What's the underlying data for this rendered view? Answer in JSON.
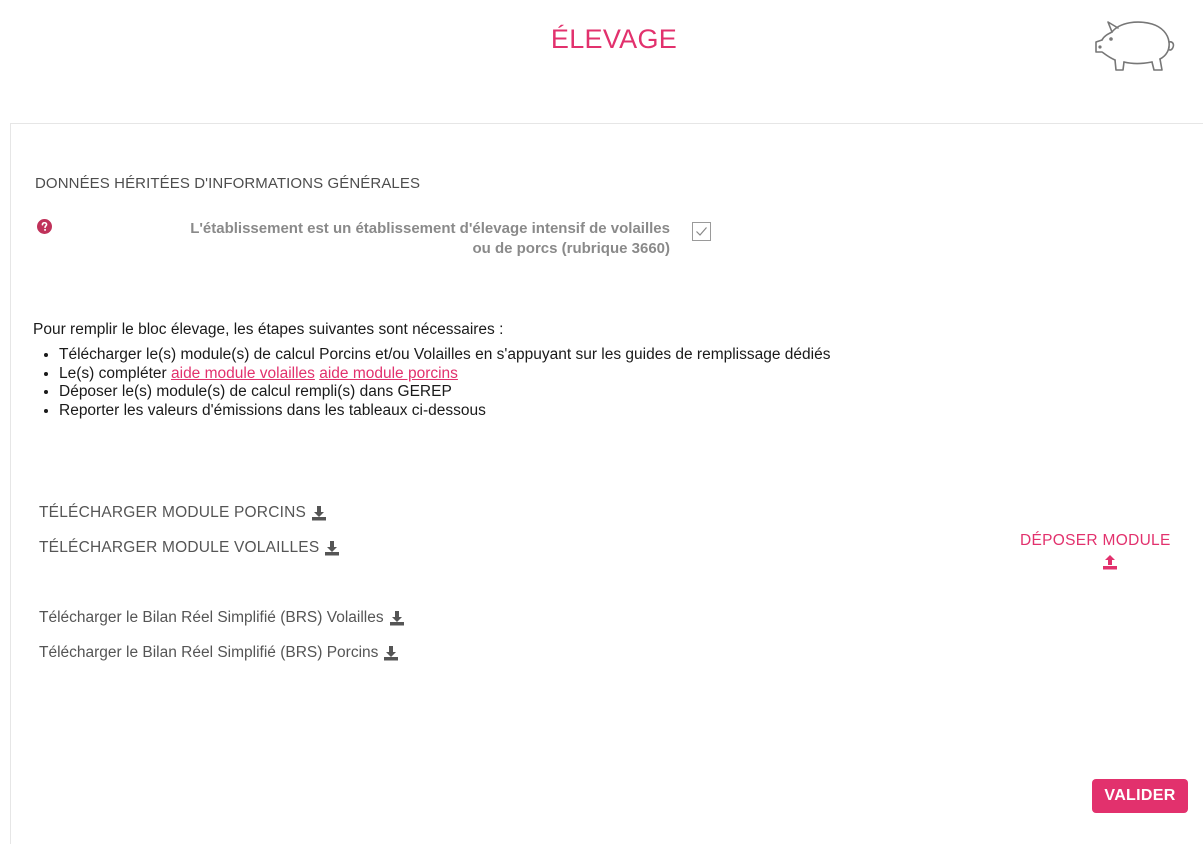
{
  "header": {
    "title": "ÉLEVAGE",
    "icon": "pig-icon"
  },
  "inherited": {
    "section_title": "DONNÉES HÉRITÉES D'INFORMATIONS GÉNÉRALES",
    "question_line1": "L'établissement est un établissement d'élevage intensif de volailles",
    "question_line2": "ou de porcs (rubrique 3660)",
    "checked": true
  },
  "instructions": {
    "intro": "Pour remplir le bloc élevage, les étapes suivantes sont nécessaires :",
    "step1": "Télécharger le(s) module(s) de calcul Porcins et/ou Volailles en s'appuyant sur les guides de remplissage dédiés",
    "step2_prefix": "Le(s) compléter",
    "step2_link1": "aide module volailles",
    "step2_link2": "aide module porcins",
    "step3": "Déposer le(s) module(s) de calcul rempli(s) dans GEREP",
    "step4": "Reporter les valeurs d'émissions dans les tableaux ci-dessous"
  },
  "downloads": {
    "porcins": "TÉLÉCHARGER MODULE PORCINS",
    "volailles": "TÉLÉCHARGER MODULE VOLAILLES",
    "brs_volailles": "Télécharger le Bilan Réel Simplifié (BRS) Volailles",
    "brs_porcins": "Télécharger le Bilan Réel Simplifié (BRS) Porcins"
  },
  "deposit": {
    "label": "DÉPOSER MODULE"
  },
  "actions": {
    "validate": "VALIDER"
  },
  "colors": {
    "accent": "#e2316d",
    "text": "#555555"
  }
}
